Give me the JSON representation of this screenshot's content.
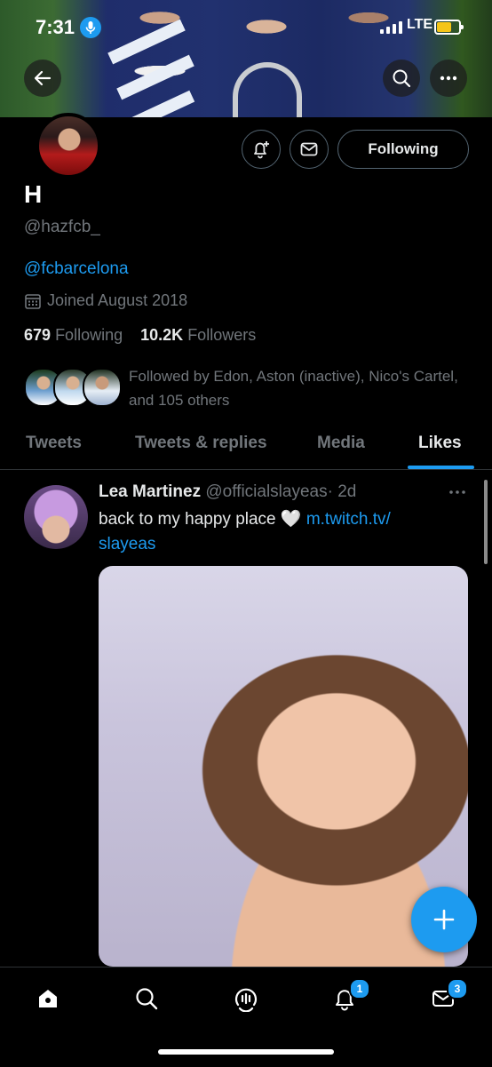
{
  "status_bar": {
    "time": "7:31",
    "network": "LTE"
  },
  "profile": {
    "name": "H",
    "handle": "@hazfcb_",
    "bio_link": "@fcbarcelona",
    "joined": "Joined August 2018",
    "following_count": "679",
    "following_label": "Following",
    "followers_count": "10.2K",
    "followers_label": "Followers",
    "followed_by": "Followed by Edon, Aston (inactive), Nico's Cartel, and 105 others",
    "follow_button": "Following"
  },
  "tabs": [
    {
      "label": "Tweets",
      "active": false
    },
    {
      "label": "Tweets & replies",
      "active": false
    },
    {
      "label": "Media",
      "active": false
    },
    {
      "label": "Likes",
      "active": true
    }
  ],
  "tweet": {
    "author_name": "Lea Martinez",
    "author_handle": "@officialslayeas",
    "time": "· 2d",
    "text": "back to my happy place 🤍 ",
    "link": "m.twitch.tv/",
    "link_cont": "slayeas"
  },
  "bottom_nav": {
    "notifications_badge": "1",
    "messages_badge": "3"
  },
  "colors": {
    "accent": "#1d9bf0",
    "background": "#000000",
    "muted": "#71767b"
  }
}
